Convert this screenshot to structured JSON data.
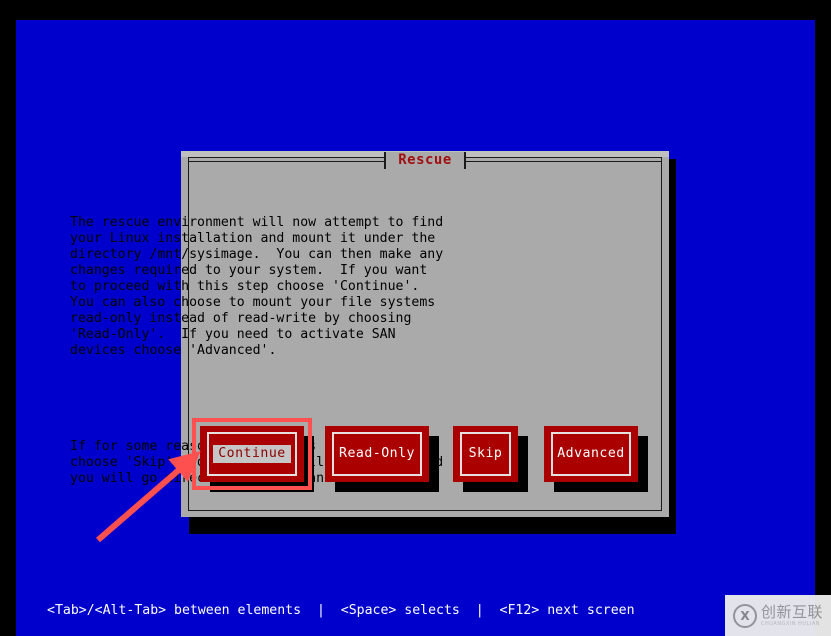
{
  "screen": {
    "background_color": "#0000CC",
    "bezel_color": "#000000"
  },
  "dialog": {
    "title": "Rescue",
    "title_color": "#A01010",
    "background_color": "#AAAAAA",
    "paragraphs": [
      "The rescue environment will now attempt to find\nyour Linux installation and mount it under the\ndirectory /mnt/sysimage.  You can then make any\nchanges required to your system.  If you want\nto proceed with this step choose 'Continue'.\nYou can also choose to mount your file systems\nread-only instead of read-write by choosing\n'Read-Only'.  If you need to activate SAN\ndevices choose 'Advanced'.",
      "If for some reason this process fails you can\nchoose 'Skip' and this step will be skipped and\nyou will go directly to a command shell."
    ],
    "buttons": [
      {
        "label": "Continue",
        "focused": true
      },
      {
        "label": "Read-Only",
        "focused": false
      },
      {
        "label": "Skip",
        "focused": false
      },
      {
        "label": "Advanced",
        "focused": false
      }
    ],
    "button_color": "#AA0000",
    "button_text_color": "#FFFFFF",
    "focused_button_text_color": "#8B0000"
  },
  "annotation": {
    "color": "#FF5050",
    "highlighted_button": "Continue"
  },
  "statusbar": {
    "text": "<Tab>/<Alt-Tab> between elements  |  <Space> selects  |  <F12> next screen",
    "color": "#FFFFFF"
  },
  "watermark": {
    "mark": "X",
    "chinese": "创新互联",
    "pinyin": "CHUANGXIN HULIAN"
  }
}
